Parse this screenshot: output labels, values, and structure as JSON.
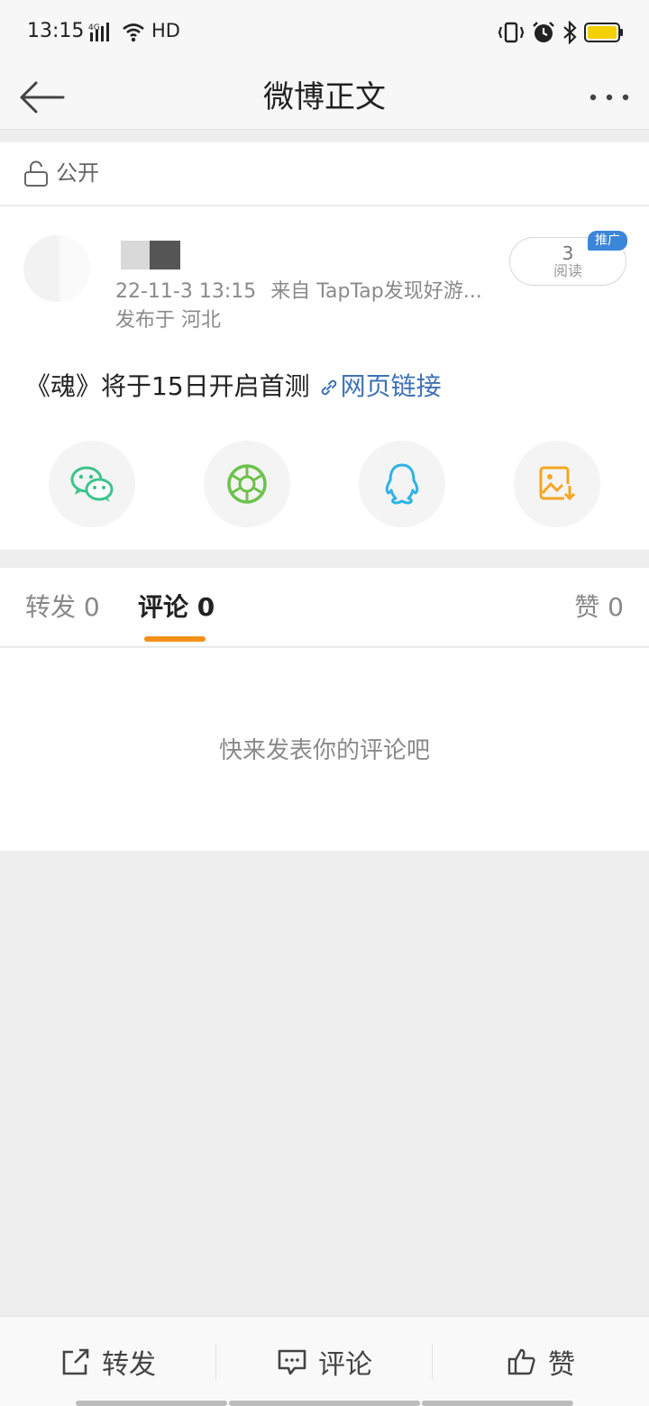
{
  "status_bar": {
    "time": "13:15",
    "network": "4G",
    "hd": "HD",
    "icons": [
      "signal-icon",
      "wifi-icon",
      "vibrate-icon",
      "alarm-icon",
      "bluetooth-icon",
      "battery-icon"
    ],
    "battery_color": "#f5d000"
  },
  "nav": {
    "title": "微博正文",
    "back_icon": "back-arrow-icon",
    "more_icon": "more-dots-icon"
  },
  "visibility": {
    "label": "公开",
    "icon": "unlock-icon"
  },
  "post": {
    "time": "22-11-3 13:15",
    "source": "来自 TapTap发现好游...",
    "location": "发布于 河北",
    "read_count": "3",
    "read_label": "阅读",
    "promo_badge": "推广",
    "text": "《魂》将于15日开启首测",
    "link_text": "网页链接",
    "share_targets": [
      {
        "icon": "wechat-icon",
        "color": "#3cc48a"
      },
      {
        "icon": "moments-icon",
        "color": "#6cc24a"
      },
      {
        "icon": "qq-icon",
        "color": "#2fb2e8"
      },
      {
        "icon": "save-image-icon",
        "color": "#f5a623"
      }
    ]
  },
  "tabs": {
    "repost": "转发 0",
    "comment": "评论 0",
    "like": "赞 0",
    "active_color": "#f2901a"
  },
  "comments": {
    "empty_text": "快来发表你的评论吧"
  },
  "toolbar": {
    "repost_label": "转发",
    "comment_label": "评论",
    "like_label": "赞"
  }
}
